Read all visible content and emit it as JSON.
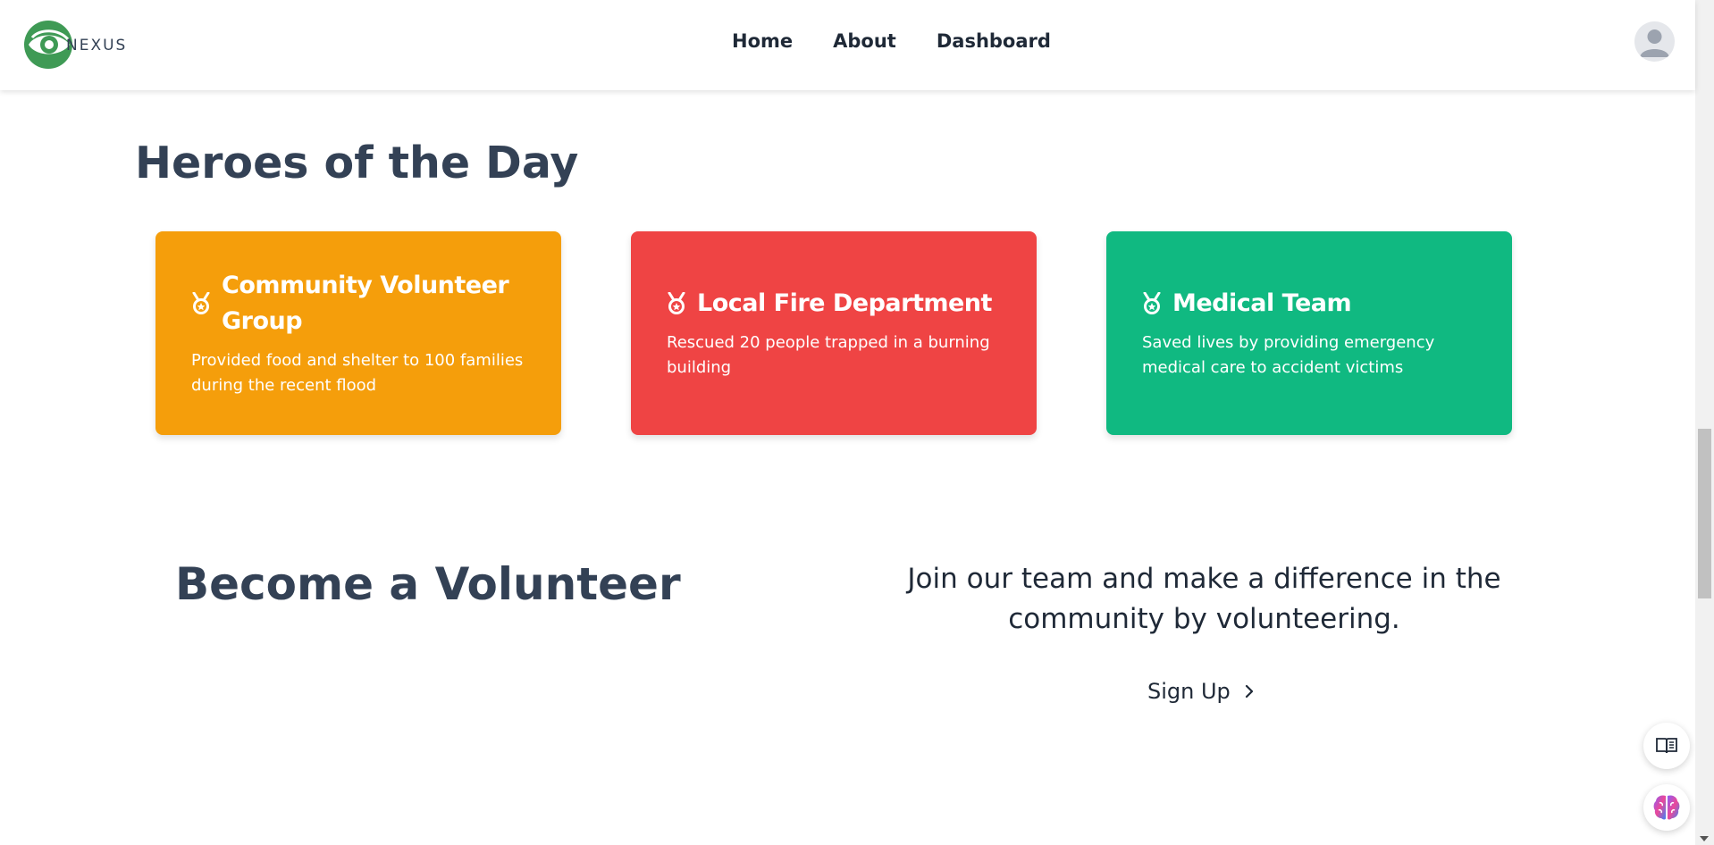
{
  "header": {
    "logo_text": "NEXUS",
    "nav": [
      {
        "label": "Home"
      },
      {
        "label": "About"
      },
      {
        "label": "Dashboard"
      }
    ]
  },
  "heroes": {
    "title": "Heroes of the Day",
    "cards": [
      {
        "title": "Community Volunteer Group",
        "description": "Provided food and shelter to 100 families during the recent flood",
        "color": "#f59e0b",
        "icon": "medal-icon"
      },
      {
        "title": "Local Fire Department",
        "description": "Rescued 20 people trapped in a burning building",
        "color": "#ef4444",
        "icon": "medal-icon"
      },
      {
        "title": "Medical Team",
        "description": "Saved lives by providing emergency medical care to accident victims",
        "color": "#10b981",
        "icon": "medal-icon"
      }
    ]
  },
  "volunteer": {
    "title": "Become a Volunteer",
    "text": "Join our team and make a difference in the community by volunteering.",
    "signup_label": "Sign Up"
  },
  "colors": {
    "logo_green": "#3f9a55",
    "heading": "#334155"
  }
}
